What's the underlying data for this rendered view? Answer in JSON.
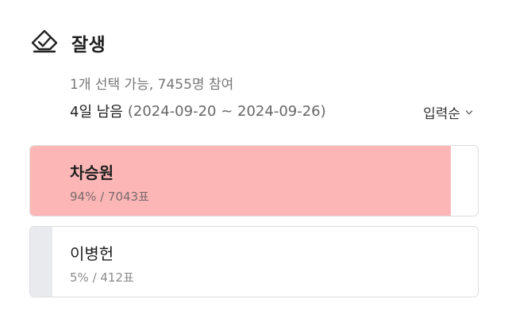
{
  "poll": {
    "title": "잘생",
    "icon": "ballot-check-icon",
    "meta": "1개 선택 가능, 7455명 참여",
    "remaining": "4일 남음",
    "period": "(2024-09-20 ~ 2024-09-26)",
    "sort_label": "입력순",
    "options": [
      {
        "label": "차승원",
        "stats": "94% / 7043표",
        "percent": 94,
        "selected": true,
        "fill_color": "#fcb6b6"
      },
      {
        "label": "이병헌",
        "stats": "5% / 412표",
        "percent": 5,
        "selected": false,
        "fill_color": "#e8eaee"
      }
    ]
  }
}
